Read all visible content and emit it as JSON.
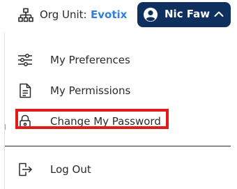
{
  "header": {
    "org_unit_label": "Org Unit:",
    "org_unit_value": "Evotix",
    "user_name": "Nic Faw"
  },
  "menu": {
    "items": [
      {
        "label": "My Preferences",
        "icon": "sliders-icon"
      },
      {
        "label": "My Permissions",
        "icon": "document-icon"
      },
      {
        "label": "Change My Password",
        "icon": "lock-icon",
        "highlighted": true
      },
      {
        "label": "Log Out",
        "icon": "logout-icon"
      }
    ]
  },
  "colors": {
    "accent": "#2f80d6",
    "user_button": "#0f2f5f",
    "highlight": "#e21a1a"
  }
}
